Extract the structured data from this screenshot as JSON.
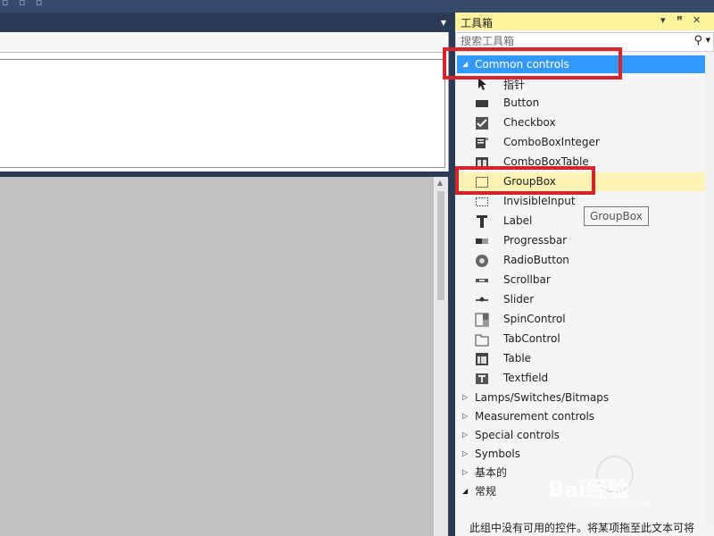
{
  "toolbox": {
    "title": "工具箱",
    "controls": {
      "dropdown": "▾",
      "pin": "ᵖ",
      "close": "✕"
    },
    "search_placeholder": "搜索工具箱",
    "categories_top": [
      {
        "label": "Common controls",
        "expanded": true,
        "selected": true
      }
    ],
    "tools": [
      {
        "label": "指针",
        "icon": "pointer-icon"
      },
      {
        "label": "Button",
        "icon": "button-icon"
      },
      {
        "label": "Checkbox",
        "icon": "checkbox-icon"
      },
      {
        "label": "ComboBoxInteger",
        "icon": "combobox-icon"
      },
      {
        "label": "ComboBoxTable",
        "icon": "combobox-table-icon"
      },
      {
        "label": "GroupBox",
        "icon": "groupbox-icon",
        "hover": true
      },
      {
        "label": "InvisibleInput",
        "icon": "invisible-input-icon"
      },
      {
        "label": "Label",
        "icon": "label-icon"
      },
      {
        "label": "Progressbar",
        "icon": "progressbar-icon"
      },
      {
        "label": "RadioButton",
        "icon": "radio-icon"
      },
      {
        "label": "Scrollbar",
        "icon": "scrollbar-icon"
      },
      {
        "label": "Slider",
        "icon": "slider-icon"
      },
      {
        "label": "SpinControl",
        "icon": "spin-icon"
      },
      {
        "label": "TabControl",
        "icon": "tab-icon"
      },
      {
        "label": "Table",
        "icon": "table-icon"
      },
      {
        "label": "Textfield",
        "icon": "textfield-icon"
      }
    ],
    "categories_bottom": [
      {
        "label": "Lamps/Switches/Bitmaps",
        "expanded": false
      },
      {
        "label": "Measurement controls",
        "expanded": false
      },
      {
        "label": "Special controls",
        "expanded": false
      },
      {
        "label": "Symbols",
        "expanded": false
      },
      {
        "label": "基本的",
        "expanded": false
      },
      {
        "label": "常规",
        "expanded": true
      }
    ],
    "empty_message": "此组中没有可用的控件。将某项拖至此文本可将"
  },
  "tooltip": "GroupBox",
  "watermark": {
    "logo": "Bai经验",
    "url": "jingyan.baidu.com"
  },
  "colors": {
    "selection": "#3399ff",
    "hover": "#fff2b5",
    "titlebar": "#fff29d",
    "highlight_box": "#d8232a"
  }
}
